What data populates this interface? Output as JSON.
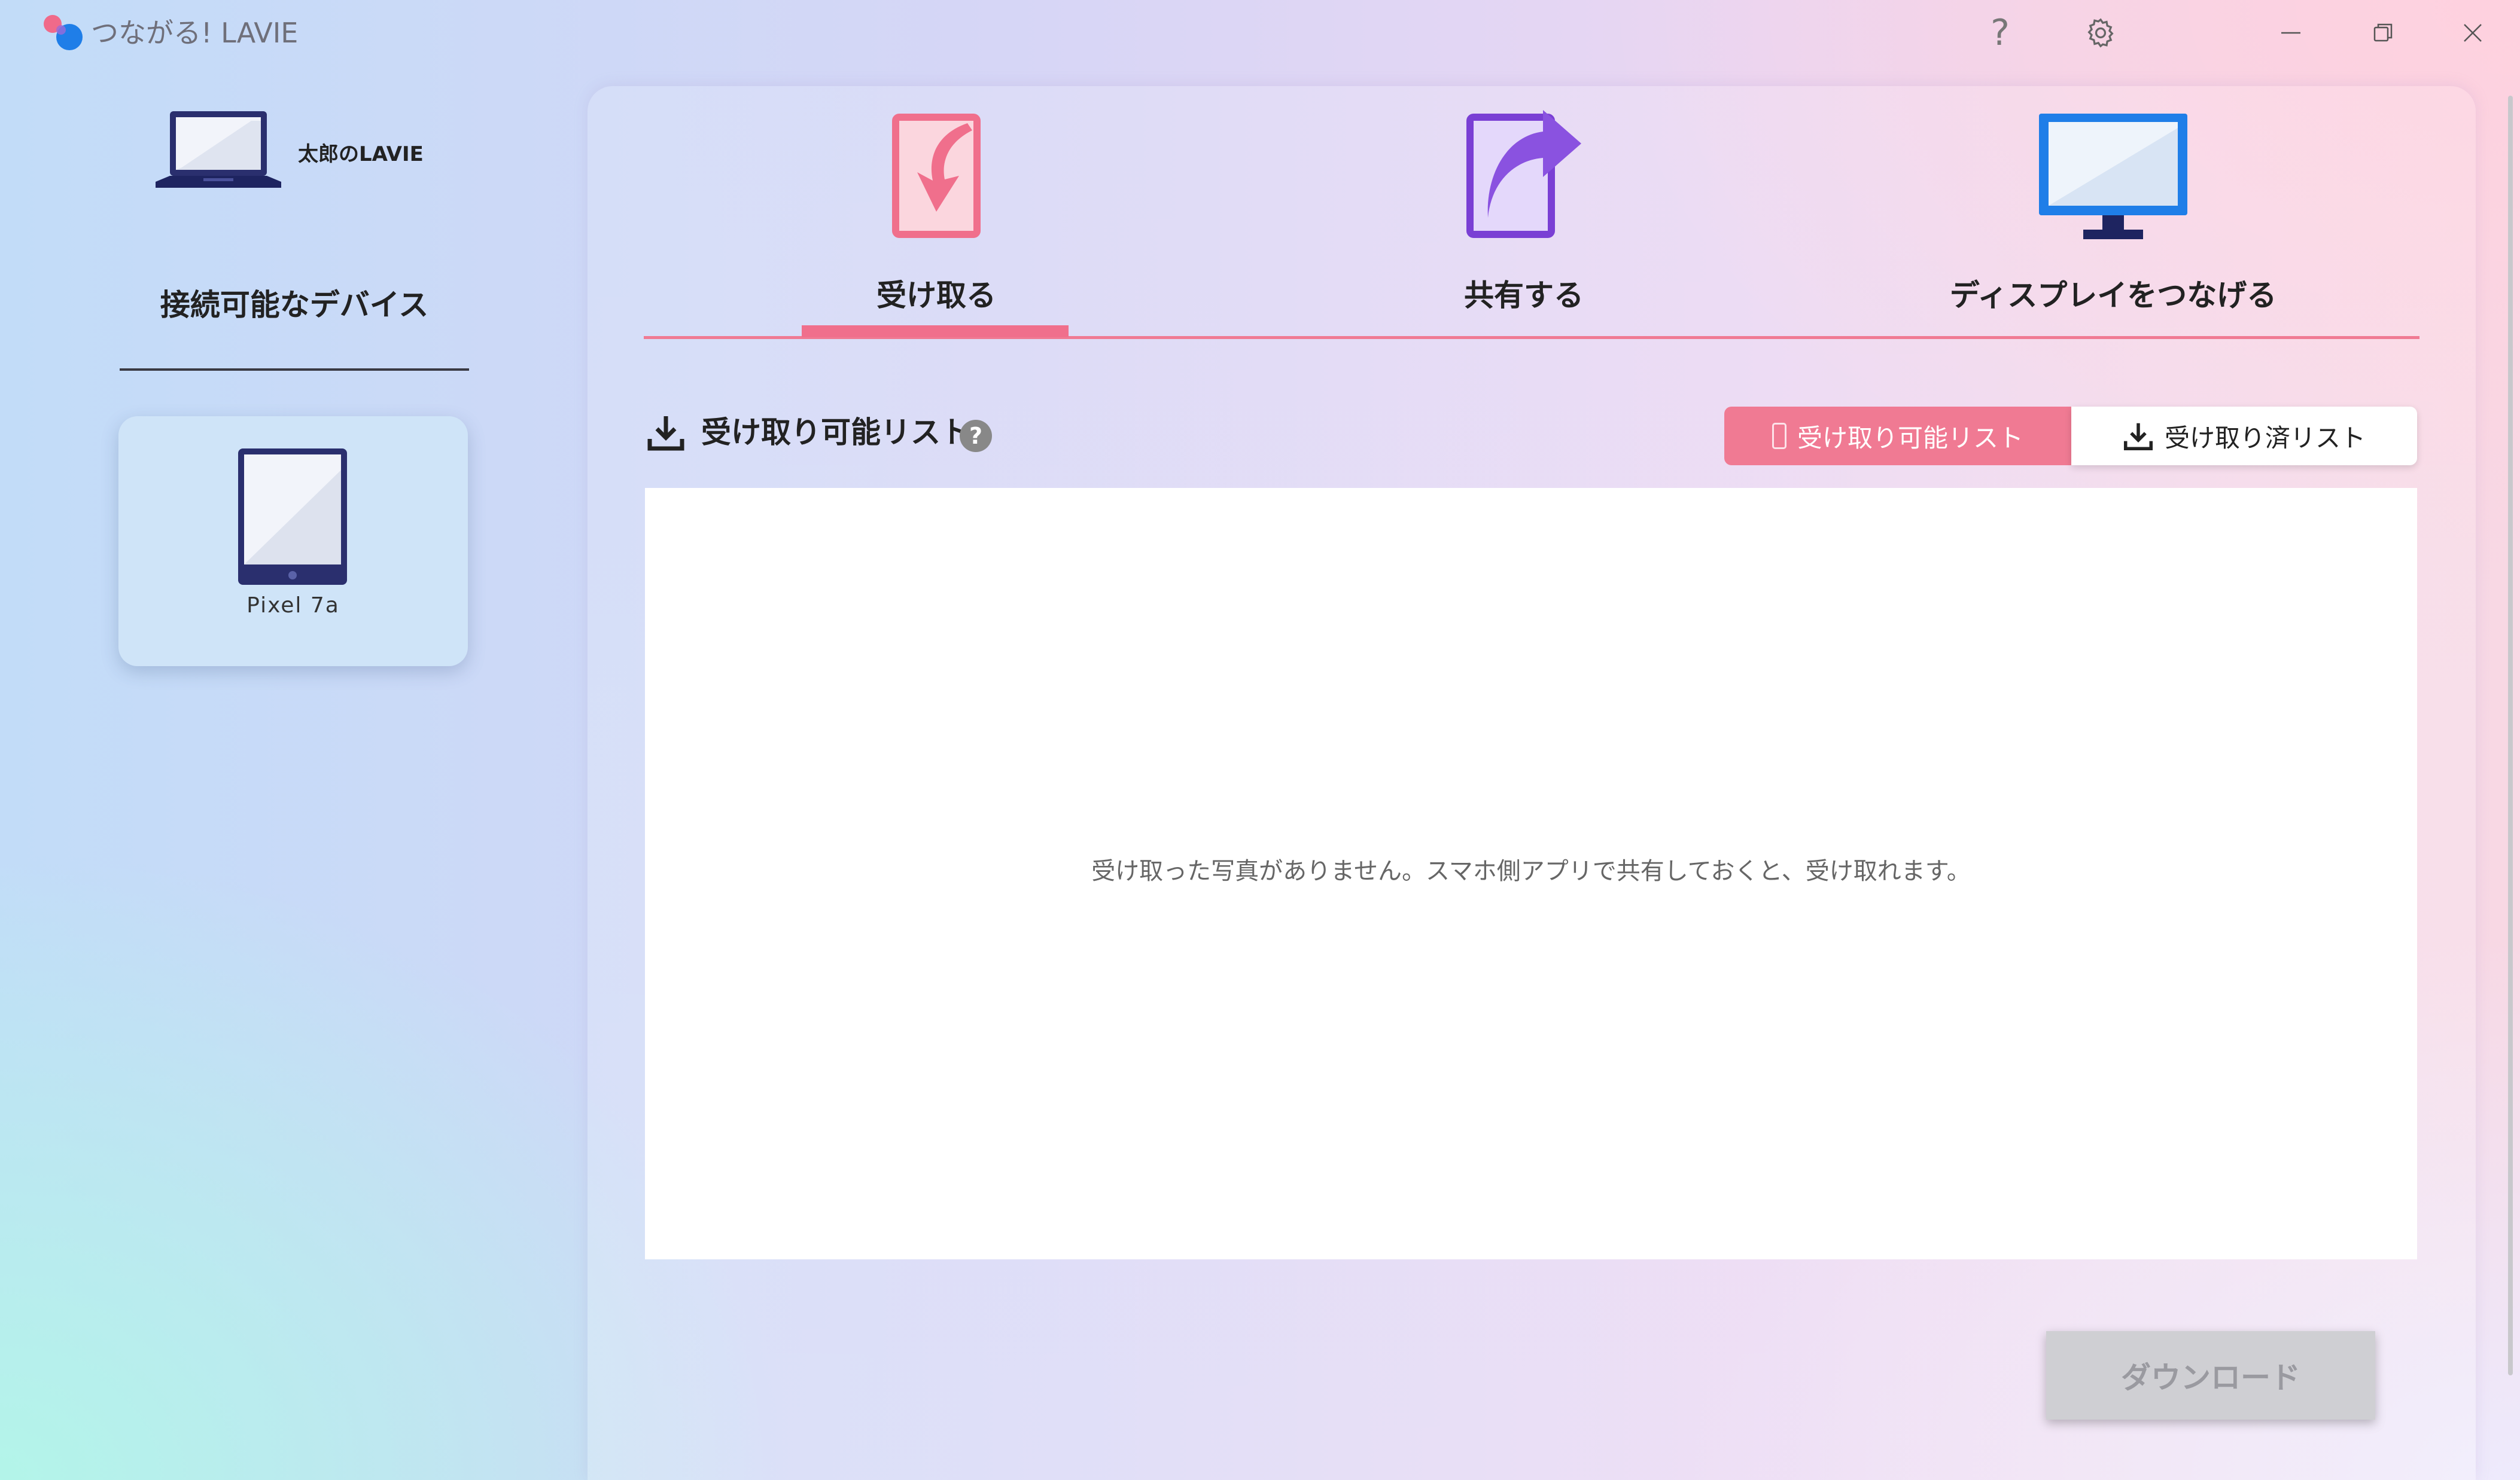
{
  "window": {
    "title": "つながる! LAVIE",
    "help_glyph": "?"
  },
  "sidebar": {
    "own_device_name": "太郎のLAVIE",
    "heading": "接続可能なデバイス",
    "connected_device_name": "Pixel 7a"
  },
  "tabs": [
    {
      "label": "受け取る",
      "active": true
    },
    {
      "label": "共有する",
      "active": false
    },
    {
      "label": "ディスプレイをつなげる",
      "active": false
    }
  ],
  "receive": {
    "section_title": "受け取り可能リスト",
    "help_glyph": "?",
    "toggle": {
      "available_label": "受け取り可能リスト",
      "received_label": "受け取り済リスト",
      "selected": "available"
    },
    "empty_message": "受け取った写真がありません。スマホ側アプリで共有しておくと、受け取れます。",
    "download_label": "ダウンロード"
  },
  "colors": {
    "accent_pink": "#f07a93",
    "download_disabled": "#cfcfd3",
    "share_purple": "#7a3fd4",
    "display_blue": "#1f7ee8"
  }
}
